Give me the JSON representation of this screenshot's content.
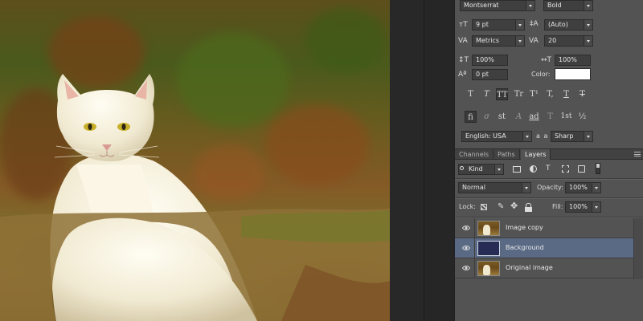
{
  "character_panel": {
    "font_family": "Montserrat",
    "font_style": "Bold",
    "font_size": "9 pt",
    "leading": "(Auto)",
    "kerning": "Metrics",
    "tracking": "20",
    "vertical_scale": "100%",
    "horizontal_scale": "100%",
    "baseline_shift": "0 pt",
    "color_label": "Color:",
    "color_value": "#ffffff",
    "type_style_buttons": [
      "T",
      "T",
      "TT",
      "Tr",
      "T¹",
      "T,",
      "T",
      "T"
    ],
    "opentype_buttons": [
      "fi",
      "σ",
      "st",
      "A",
      "ad",
      "T",
      "1st",
      "½"
    ],
    "language": "English: USA",
    "aa_label": "a a",
    "antialias": "Sharp"
  },
  "layers_panel": {
    "tabs": [
      "Channels",
      "Paths",
      "Layers"
    ],
    "active_tab": "Layers",
    "filter_kind": "Kind",
    "blend_mode": "Normal",
    "opacity_label": "Opacity:",
    "opacity": "100%",
    "lock_label": "Lock:",
    "fill_label": "Fill:",
    "fill": "100%",
    "layers": [
      {
        "name": "Image copy",
        "selected": false,
        "thumb": "cat-photo"
      },
      {
        "name": "Background",
        "selected": true,
        "thumb": "navy-fill",
        "thumb_color": "#262c54"
      },
      {
        "name": "Original image",
        "selected": false,
        "thumb": "cat-photo"
      }
    ]
  },
  "colors": {
    "panel_bg": "#535353",
    "field_bg": "#3f3f3f",
    "selection": "#5a6a85",
    "canvas_bg": "#282828"
  }
}
